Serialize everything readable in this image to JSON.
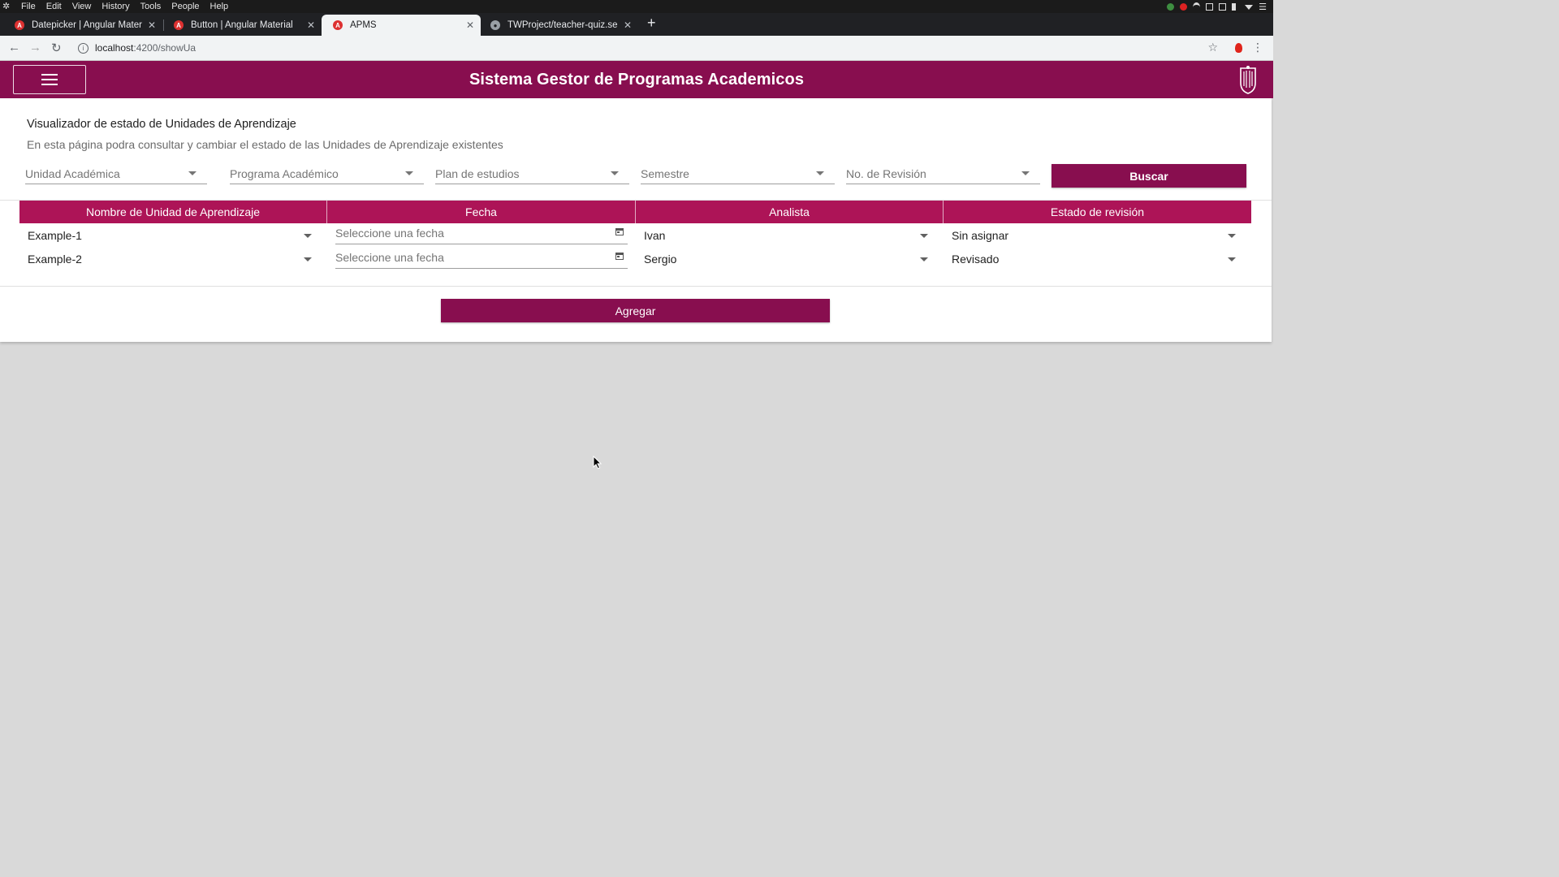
{
  "os": {
    "menu": [
      "File",
      "Edit",
      "View",
      "History",
      "Tools",
      "People",
      "Help"
    ]
  },
  "browser": {
    "tabs": [
      {
        "title": "Datepicker | Angular Mater",
        "favicon": "angular-icon",
        "active": false
      },
      {
        "title": "Button | Angular Material",
        "favicon": "angular-icon",
        "active": false
      },
      {
        "title": "APMS",
        "favicon": "angular-icon",
        "active": true
      },
      {
        "title": "TWProject/teacher-quiz.se",
        "favicon": "github-icon",
        "active": false
      }
    ],
    "url_host": "localhost",
    "url_path": ":4200/showUa"
  },
  "app": {
    "title": "Sistema Gestor de Programas Academicos",
    "brand_color": "#880e4f",
    "header_color": "#ad1457"
  },
  "page": {
    "heading": "Visualizador de estado de Unidades de Aprendizaje",
    "subtitle": "En esta página podra consultar y cambiar el estado de las Unidades de Aprendizaje existentes",
    "filters": [
      "Unidad Académica",
      "Programa Académico",
      "Plan de estudios",
      "Semestre",
      "No. de Revisión"
    ],
    "search_button": "Buscar",
    "add_button": "Agregar"
  },
  "table": {
    "columns": [
      "Nombre de Unidad de Aprendizaje",
      "Fecha",
      "Analista",
      "Estado de revisión"
    ],
    "rows": [
      {
        "unidad": "Example-1",
        "fecha_placeholder": "Seleccione una fecha",
        "analista": "Ivan",
        "estado": "Sin asignar"
      },
      {
        "unidad": "Example-2",
        "fecha_placeholder": "Seleccione una fecha",
        "analista": "Sergio",
        "estado": "Revisado"
      }
    ]
  }
}
